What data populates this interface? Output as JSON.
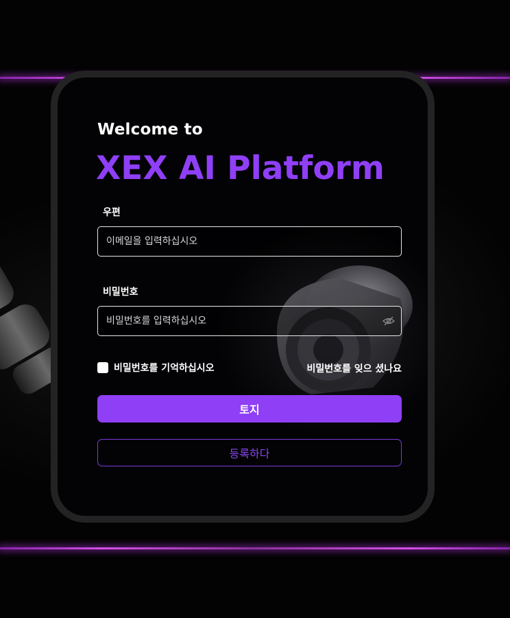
{
  "colors": {
    "accent": "#8f3ff5",
    "background": "#000000",
    "card_frame": "#232323",
    "glow": "#c850e6"
  },
  "header": {
    "welcome": "Welcome to",
    "brand": "XEX AI Platform"
  },
  "form": {
    "email": {
      "label": "우편",
      "placeholder": "이메일을 입력하십시오",
      "value": ""
    },
    "password": {
      "label": "비밀번호",
      "placeholder": "비밀번호를 입력하십시오",
      "value": "",
      "toggle_icon": "eye-off-icon"
    },
    "remember_label": "비밀번호를 기억하십시오",
    "remember_checked": false,
    "forgot_label": "비밀번호를 잊으 셨나요"
  },
  "actions": {
    "submit_label": "토지",
    "register_label": "등록하다"
  }
}
